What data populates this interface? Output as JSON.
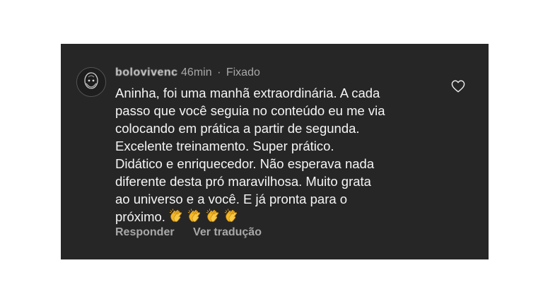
{
  "comment": {
    "username": "bolovivenc",
    "time": "46min",
    "separator": "·",
    "pinned_label": "Fixado",
    "text": "Aninha, foi uma manhã extraordinária.  A cada\npasso que você seguia no conteúdo eu me via\ncolocando em prática a partir de segunda.\nExcelente treinamento.  Super prático.\nDidático e enriquecedor.  Não esperava nada\ndiferente desta pró maravilhosa.  Muito grata\nao universo e a você.  E já pronta para o\npróximo.",
    "emoji_icon": "clapping-hands-icon",
    "emoji_count": 4
  },
  "actions": {
    "reply_label": "Responder",
    "translate_label": "Ver tradução"
  },
  "icons": {
    "like": "heart-outline-icon",
    "avatar": "avatar"
  },
  "colors": {
    "card_background": "#262626",
    "text": "#f5f5f5",
    "muted": "#a8a8a8"
  }
}
